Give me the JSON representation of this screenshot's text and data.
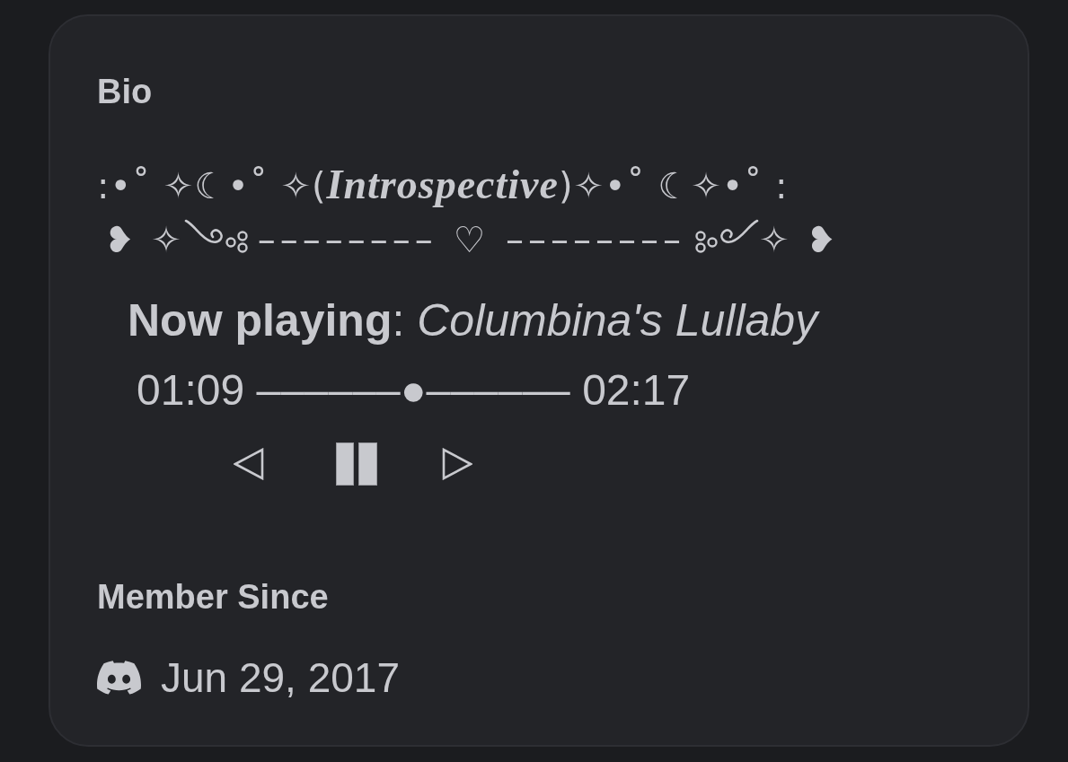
{
  "bio": {
    "heading": "Bio",
    "title_line": ":•˚ ✧☾•˚ ✧(*Introspective*)✧•˚ ☾✧•˚ :",
    "divider": {
      "left": "❥ ✧",
      "middle": "–––––––– ♡ ––––––––",
      "right": "✧ ❥"
    },
    "now_playing": "**Now playing**: *Columbina's Lullaby*",
    "progress": "01:09 ––––––●–––––– 02:17",
    "controls": {
      "playing": true
    }
  },
  "member_since": {
    "heading": "Member Since",
    "date": "Jun 29, 2017"
  }
}
